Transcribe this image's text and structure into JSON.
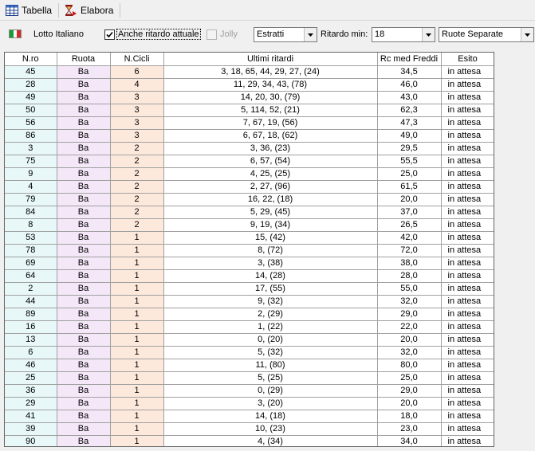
{
  "toolbar": {
    "tabella_label": "Tabella",
    "elabora_label": "Elabora"
  },
  "options": {
    "lotto_label": "Lotto Italiano",
    "anche_ritardo_label": "Anche ritardo attuale",
    "anche_ritardo_checked": true,
    "jolly_label": "Jolly",
    "jolly_checked": false,
    "estratti_value": "Estratti",
    "ritardo_min_label": "Ritardo min:",
    "ritardo_min_value": "18",
    "ruote_value": "Ruote Separate"
  },
  "colors": {
    "nro_bg": "#e8f8f8",
    "ruota_bg": "#f4e8f8",
    "cicli_bg": "#fde9dc"
  },
  "table": {
    "headers": [
      "N.ro",
      "Ruota",
      "N.Cicli",
      "Ultimi ritardi",
      "Rc med Freddi",
      "Esito"
    ],
    "rows": [
      [
        "45",
        "Ba",
        "6",
        "3, 18, 65, 44, 29, 27, (24)",
        "34,5",
        "in attesa"
      ],
      [
        "28",
        "Ba",
        "4",
        "11, 29, 34, 43, (78)",
        "46,0",
        "in attesa"
      ],
      [
        "49",
        "Ba",
        "3",
        "14, 20, 30, (79)",
        "43,0",
        "in attesa"
      ],
      [
        "50",
        "Ba",
        "3",
        "5, 114, 52, (21)",
        "62,3",
        "in attesa"
      ],
      [
        "56",
        "Ba",
        "3",
        "7, 67, 19, (56)",
        "47,3",
        "in attesa"
      ],
      [
        "86",
        "Ba",
        "3",
        "6, 67, 18, (62)",
        "49,0",
        "in attesa"
      ],
      [
        "3",
        "Ba",
        "2",
        "3, 36, (23)",
        "29,5",
        "in attesa"
      ],
      [
        "75",
        "Ba",
        "2",
        "6, 57, (54)",
        "55,5",
        "in attesa"
      ],
      [
        "9",
        "Ba",
        "2",
        "4, 25, (25)",
        "25,0",
        "in attesa"
      ],
      [
        "4",
        "Ba",
        "2",
        "2, 27, (96)",
        "61,5",
        "in attesa"
      ],
      [
        "79",
        "Ba",
        "2",
        "16, 22, (18)",
        "20,0",
        "in attesa"
      ],
      [
        "84",
        "Ba",
        "2",
        "5, 29, (45)",
        "37,0",
        "in attesa"
      ],
      [
        "8",
        "Ba",
        "2",
        "9, 19, (34)",
        "26,5",
        "in attesa"
      ],
      [
        "53",
        "Ba",
        "1",
        "15, (42)",
        "42,0",
        "in attesa"
      ],
      [
        "78",
        "Ba",
        "1",
        "8, (72)",
        "72,0",
        "in attesa"
      ],
      [
        "69",
        "Ba",
        "1",
        "3, (38)",
        "38,0",
        "in attesa"
      ],
      [
        "64",
        "Ba",
        "1",
        "14, (28)",
        "28,0",
        "in attesa"
      ],
      [
        "2",
        "Ba",
        "1",
        "17, (55)",
        "55,0",
        "in attesa"
      ],
      [
        "44",
        "Ba",
        "1",
        "9, (32)",
        "32,0",
        "in attesa"
      ],
      [
        "89",
        "Ba",
        "1",
        "2, (29)",
        "29,0",
        "in attesa"
      ],
      [
        "16",
        "Ba",
        "1",
        "1, (22)",
        "22,0",
        "in attesa"
      ],
      [
        "13",
        "Ba",
        "1",
        "0, (20)",
        "20,0",
        "in attesa"
      ],
      [
        "6",
        "Ba",
        "1",
        "5, (32)",
        "32,0",
        "in attesa"
      ],
      [
        "46",
        "Ba",
        "1",
        "11, (80)",
        "80,0",
        "in attesa"
      ],
      [
        "25",
        "Ba",
        "1",
        "5, (25)",
        "25,0",
        "in attesa"
      ],
      [
        "36",
        "Ba",
        "1",
        "0, (29)",
        "29,0",
        "in attesa"
      ],
      [
        "29",
        "Ba",
        "1",
        "3, (20)",
        "20,0",
        "in attesa"
      ],
      [
        "41",
        "Ba",
        "1",
        "14, (18)",
        "18,0",
        "in attesa"
      ],
      [
        "39",
        "Ba",
        "1",
        "10, (23)",
        "23,0",
        "in attesa"
      ],
      [
        "90",
        "Ba",
        "1",
        "4, (34)",
        "34,0",
        "in attesa"
      ]
    ]
  }
}
